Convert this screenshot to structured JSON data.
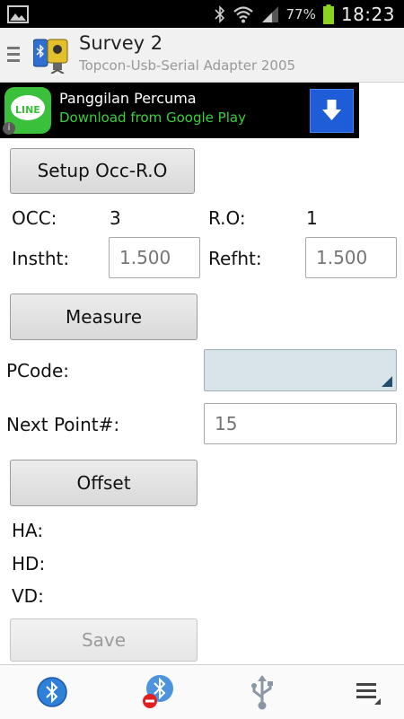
{
  "status_bar": {
    "battery_percent": "77%",
    "time": "18:23"
  },
  "action_bar": {
    "title": "Survey 2",
    "subtitle": "Topcon-Usb-Serial Adapter 2005"
  },
  "ad": {
    "logo_text": "LINE",
    "title": "Panggilan Percuma",
    "subtitle": "Download from Google Play",
    "info_glyph": "i"
  },
  "form": {
    "setup_button": "Setup Occ-R.O",
    "occ_label": "OCC:",
    "occ_value": "3",
    "ro_label": "R.O:",
    "ro_value": "1",
    "instht_label": "Instht:",
    "instht_placeholder": "1.500",
    "refht_label": "Refht:",
    "refht_placeholder": "1.500",
    "measure_button": "Measure",
    "pcode_label": "PCode:",
    "next_point_label": "Next Point#:",
    "next_point_placeholder": "15",
    "offset_button": "Offset",
    "ha_label": "HA:",
    "hd_label": "HD:",
    "vd_label": "VD:",
    "save_button": "Save"
  },
  "bottom_bar": {
    "items": [
      "bluetooth-connect-icon",
      "bluetooth-disconnect-icon",
      "usb-icon",
      "overflow-menu-icon"
    ]
  },
  "colors": {
    "ad_accent": "#3ac03a",
    "download_blue": "#1e5cd8",
    "bluetooth_blue": "#2f80d8",
    "stop_red": "#e02020"
  }
}
